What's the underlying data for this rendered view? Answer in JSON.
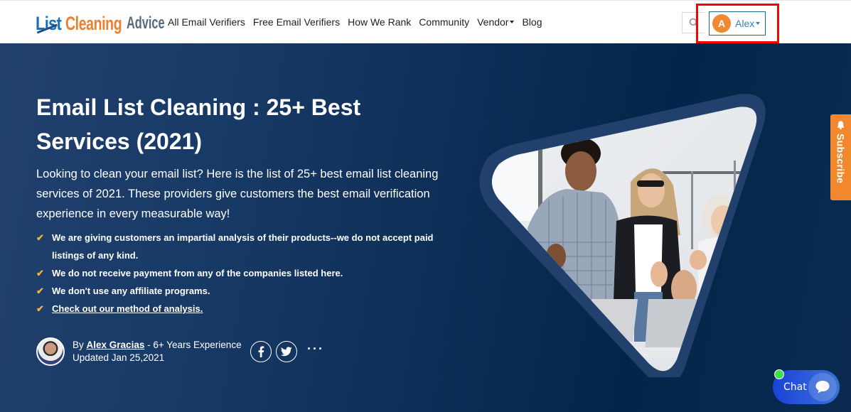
{
  "header": {
    "logo": {
      "part1": "List",
      "part2": "Cleaning",
      "part3": "Advice"
    },
    "nav": [
      {
        "label": "All Email Verifiers"
      },
      {
        "label": "Free Email Verifiers"
      },
      {
        "label": "How We Rank"
      },
      {
        "label": "Community"
      },
      {
        "label": "Vendor",
        "dropdown": true
      },
      {
        "label": "Blog"
      }
    ],
    "search_icon": "search-icon",
    "user": {
      "initial": "A",
      "name": "Alex",
      "avatar_color": "#ef8a33"
    }
  },
  "hero": {
    "title": "Email List Cleaning : 25+ Best Services (2021)",
    "description": "Looking to clean your email list? Here is the list of 25+ best email list cleaning services of 2021. These providers give customers the best email verification experience in every measurable way!",
    "checklist": [
      "We are giving customers an impartial analysis of their products--we do not accept paid listings of any kind.",
      "We do not receive payment from any of the companies listed here.",
      "We don't use any affiliate programs.",
      "Check out our method of analysis."
    ],
    "author": {
      "by": "By",
      "name": "Alex Gracias",
      "experience": "- 6+ Years Experience",
      "updated": "Updated Jan 25,2021"
    },
    "share": {
      "facebook_icon": "facebook-icon",
      "twitter_icon": "twitter-icon",
      "more": "···"
    },
    "image_alt": "Team of smiling coworkers giving thumbs up"
  },
  "widgets": {
    "subscribe": "Subscribe",
    "chat": "Chat"
  },
  "colors": {
    "brand_blue": "#1d6fb8",
    "brand_orange": "#e9812f",
    "hero_dark": "#022649",
    "check": "#f3b33d",
    "highlight": "#ff0000",
    "chat_online": "#3ce04a"
  }
}
